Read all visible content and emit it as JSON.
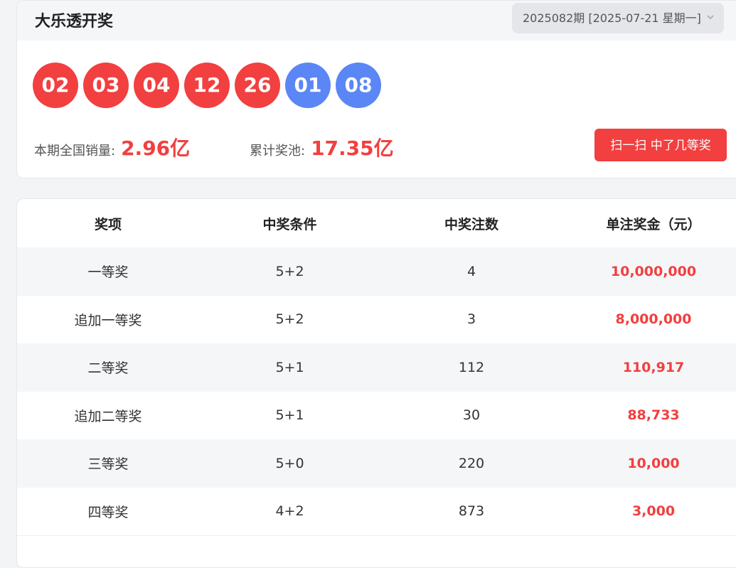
{
  "header": {
    "title": "大乐透开奖",
    "period_select": "2025082期 [2025-07-21 星期一]"
  },
  "draw": {
    "front_balls": [
      "02",
      "03",
      "04",
      "12",
      "26"
    ],
    "back_balls": [
      "01",
      "08"
    ],
    "sales_label": "本期全国销量:",
    "sales_value": "2.96亿",
    "pool_label": "累计奖池:",
    "pool_value": "17.35亿",
    "scan_button": "扫一扫 中了几等奖"
  },
  "table": {
    "headers": [
      "奖项",
      "中奖条件",
      "中奖注数",
      "单注奖金（元）"
    ],
    "rows": [
      [
        "一等奖",
        "5+2",
        "4",
        "10,000,000"
      ],
      [
        "追加一等奖",
        "5+2",
        "3",
        "8,000,000"
      ],
      [
        "二等奖",
        "5+1",
        "112",
        "110,917"
      ],
      [
        "追加二等奖",
        "5+1",
        "30",
        "88,733"
      ],
      [
        "三等奖",
        "5+0",
        "220",
        "10,000"
      ],
      [
        "四等奖",
        "4+2",
        "873",
        "3,000"
      ]
    ]
  },
  "colors": {
    "red_ball": "#f23f3f",
    "blue_ball": "#5b86f5",
    "accent": "#f23f3f"
  }
}
